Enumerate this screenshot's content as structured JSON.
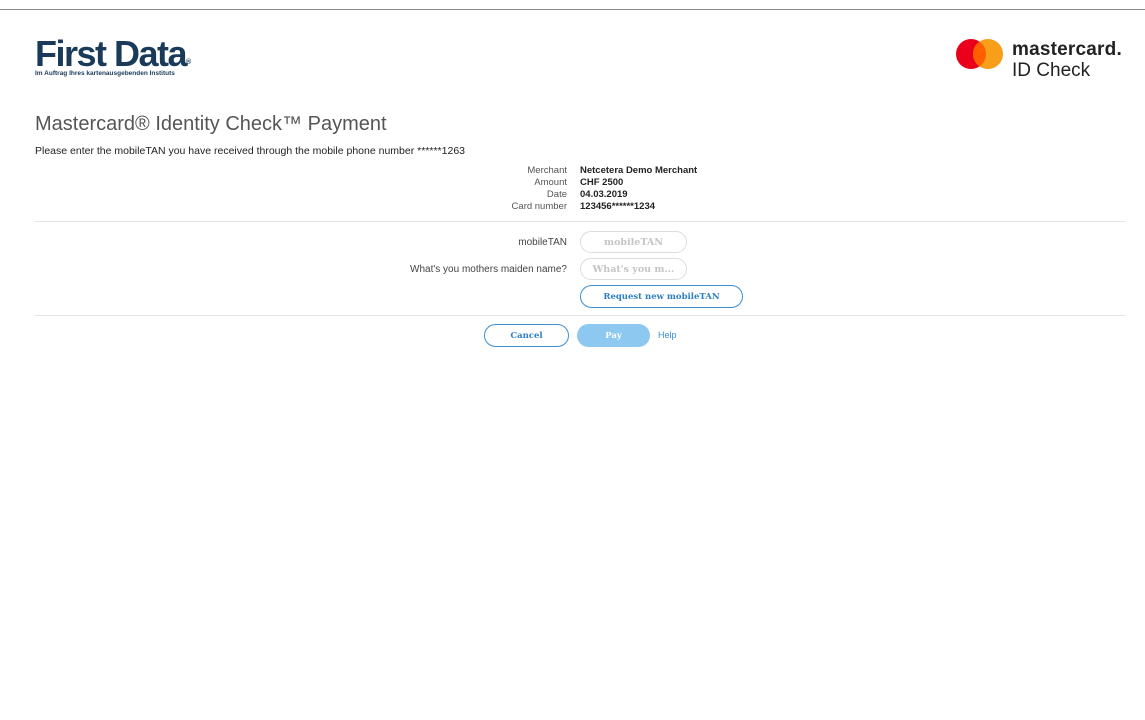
{
  "header": {
    "issuer_logo": {
      "name": "First Data",
      "registered_mark": "®",
      "tagline": "Im Auftrag Ihres kartenausgebenden Instituts"
    },
    "network_logo": {
      "line1": "mastercard",
      "registered_mark": ".",
      "line2": "ID Check"
    }
  },
  "page": {
    "title": "Mastercard® Identity Check™ Payment",
    "instruction": "Please enter the mobileTAN you have received through the mobile phone number ******1263"
  },
  "transaction": [
    {
      "label": "Merchant",
      "value": "Netcetera Demo Merchant"
    },
    {
      "label": "Amount",
      "value": "CHF 2500"
    },
    {
      "label": "Date",
      "value": "04.03.2019"
    },
    {
      "label": "Card number",
      "value": "123456******1234"
    }
  ],
  "form": {
    "mobiletan": {
      "label": "mobileTAN",
      "placeholder": "mobileTAN",
      "value": ""
    },
    "maiden_name": {
      "label": "What's you mothers maiden name?",
      "placeholder": "What's you m...",
      "value": ""
    },
    "request_new_label": "Request new mobileTAN"
  },
  "actions": {
    "cancel_label": "Cancel",
    "pay_label": "Pay",
    "help_label": "Help"
  },
  "colors": {
    "first_data_navy": "#1a3a5a",
    "mc_red": "#eb001b",
    "mc_orange": "#f79e1b",
    "mc_overlap": "#ff5f00",
    "accent_blue": "#3a8fd4",
    "pay_disabled": "#8cc8ef"
  }
}
